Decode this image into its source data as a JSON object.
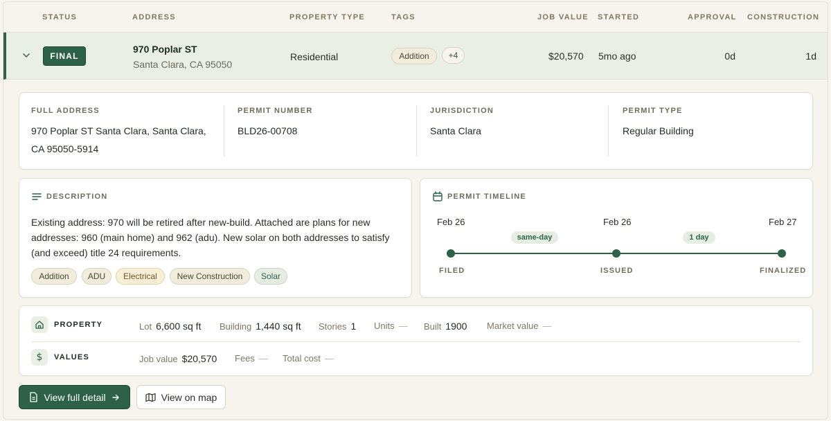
{
  "header": {
    "status": "STATUS",
    "address": "ADDRESS",
    "property_type": "PROPERTY TYPE",
    "tags": "TAGS",
    "job_value": "JOB VALUE",
    "started": "STARTED",
    "approval": "APPROVAL",
    "construction": "CONSTRUCTION"
  },
  "row": {
    "status": "FINAL",
    "address_line1": "970 Poplar ST",
    "address_line2": "Santa Clara, CA 95050",
    "property_type": "Residential",
    "tag": "Addition",
    "more_tags": "+4",
    "job_value": "$20,570",
    "started": "5mo ago",
    "approval": "0d",
    "construction": "1d"
  },
  "details": {
    "full_address_label": "FULL ADDRESS",
    "full_address_line1": "970 Poplar ST Santa Clara, Santa Clara,",
    "full_address_line2": "CA 95050-5914",
    "permit_number_label": "PERMIT NUMBER",
    "permit_number": "BLD26-00708",
    "jurisdiction_label": "JURISDICTION",
    "jurisdiction": "Santa Clara",
    "permit_type_label": "PERMIT TYPE",
    "permit_type": "Regular Building"
  },
  "description": {
    "title": "DESCRIPTION",
    "text": "Existing address: 970 will be retired after new-build. Attached are plans for new addresses: 960 (main home) and 962 (adu). New solar on both addresses to satisfy (and exceed) title 24 requirements.",
    "tags": [
      "Addition",
      "ADU",
      "Electrical",
      "New Construction",
      "Solar"
    ]
  },
  "timeline": {
    "title": "PERMIT TIMELINE",
    "dates": [
      "Feb 26",
      "Feb 26",
      "Feb 27"
    ],
    "gaps": [
      "same-day",
      "1 day"
    ],
    "stages": [
      "FILED",
      "ISSUED",
      "FINALIZED"
    ]
  },
  "property": {
    "title": "PROPERTY",
    "lot_label": "Lot",
    "lot": "6,600 sq ft",
    "building_label": "Building",
    "building": "1,440 sq ft",
    "stories_label": "Stories",
    "stories": "1",
    "units_label": "Units",
    "units": "—",
    "built_label": "Built",
    "built": "1900",
    "market_label": "Market value",
    "market": "—"
  },
  "values": {
    "title": "VALUES",
    "job_value_label": "Job value",
    "job_value": "$20,570",
    "fees_label": "Fees",
    "fees": "—",
    "total_cost_label": "Total cost",
    "total_cost": "—"
  },
  "actions": {
    "view_detail": "View full detail",
    "view_map": "View on map"
  },
  "colors": {
    "accent": "#2d6148",
    "row_highlight": "#e9efe4",
    "background": "#f6f4ec"
  }
}
